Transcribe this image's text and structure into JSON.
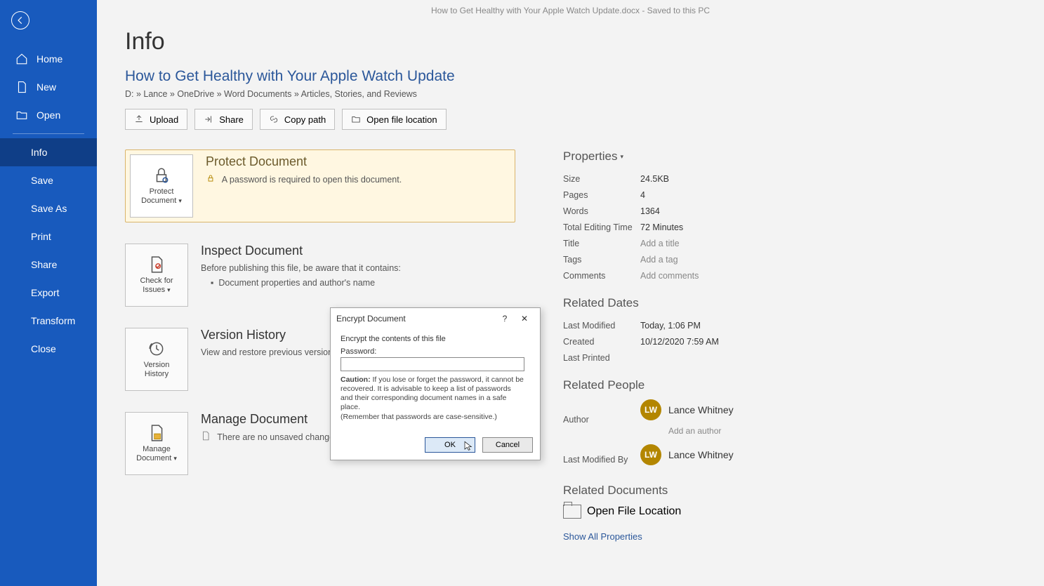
{
  "titlebar": "How to Get Healthy with Your Apple Watch Update.docx  -  Saved to this PC",
  "sidebar": {
    "home": "Home",
    "new": "New",
    "open": "Open",
    "info": "Info",
    "save": "Save",
    "saveas": "Save As",
    "print": "Print",
    "share": "Share",
    "export": "Export",
    "transform": "Transform",
    "close": "Close"
  },
  "page": {
    "title": "Info",
    "doc_title": "How to Get Healthy with Your Apple Watch Update",
    "breadcrumb": "D: » Lance » OneDrive » Word Documents » Articles, Stories, and Reviews"
  },
  "actions": {
    "upload": "Upload",
    "share": "Share",
    "copy_path": "Copy path",
    "open_loc": "Open file location"
  },
  "cards": {
    "protect": {
      "btn1": "Protect",
      "btn2": "Document",
      "title": "Protect Document",
      "text": "A password is required to open this document."
    },
    "inspect": {
      "btn1": "Check for",
      "btn2": "Issues",
      "title": "Inspect Document",
      "text": "Before publishing this file, be aware that it contains:",
      "bullet": "Document properties and author's name"
    },
    "history": {
      "btn1": "Version",
      "btn2": "History",
      "title": "Version History",
      "text": "View and restore previous versions."
    },
    "manage": {
      "btn1": "Manage",
      "btn2": "Document",
      "title": "Manage Document",
      "text": "There are no unsaved changes."
    }
  },
  "props": {
    "header": "Properties",
    "size_k": "Size",
    "size_v": "24.5KB",
    "pages_k": "Pages",
    "pages_v": "4",
    "words_k": "Words",
    "words_v": "1364",
    "edit_k": "Total Editing Time",
    "edit_v": "72 Minutes",
    "title_k": "Title",
    "title_v": "Add a title",
    "tags_k": "Tags",
    "tags_v": "Add a tag",
    "comments_k": "Comments",
    "comments_v": "Add comments"
  },
  "dates": {
    "header": "Related Dates",
    "mod_k": "Last Modified",
    "mod_v": "Today, 1:06 PM",
    "created_k": "Created",
    "created_v": "10/12/2020 7:59 AM",
    "printed_k": "Last Printed",
    "printed_v": ""
  },
  "people": {
    "header": "Related People",
    "author_k": "Author",
    "author_initials": "LW",
    "author_name": "Lance Whitney",
    "add_author": "Add an author",
    "modby_k": "Last Modified By",
    "modby_initials": "LW",
    "modby_name": "Lance Whitney"
  },
  "docs": {
    "header": "Related Documents",
    "open_loc": "Open File Location",
    "show_all": "Show All Properties"
  },
  "dialog": {
    "title": "Encrypt Document",
    "group_title": "Encrypt the contents of this file",
    "password_label": "Password:",
    "password_value": "",
    "caution_bold": "Caution:",
    "caution_text": " If you lose or forget the password, it cannot be recovered. It is advisable to keep a list of passwords and their corresponding document names in a safe place.",
    "caution_remember": "(Remember that passwords are case-sensitive.)",
    "ok": "OK",
    "cancel": "Cancel"
  }
}
